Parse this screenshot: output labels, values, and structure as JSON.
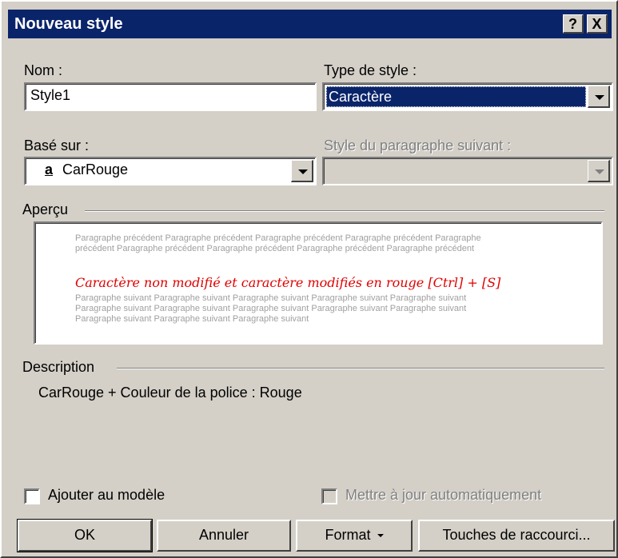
{
  "window": {
    "title": "Nouveau style",
    "help_label": "?",
    "close_label": "X"
  },
  "name_field": {
    "label": "Nom :",
    "value": "Style1"
  },
  "style_type": {
    "label": "Type de style :",
    "value": "Caractère"
  },
  "based_on": {
    "label": "Basé sur :",
    "glyph": "a",
    "value": "CarRouge"
  },
  "next_style": {
    "label": "Style du paragraphe suivant :",
    "value": ""
  },
  "preview": {
    "label": "Aperçu",
    "previous_text": "Paragraphe précédent Paragraphe précédent Paragraphe précédent Paragraphe précédent Paragraphe précédent Paragraphe précédent Paragraphe précédent Paragraphe précédent Paragraphe précédent",
    "sample_text": "Caractère non modifié et caractère modifiés en rouge [Ctrl] + [S]",
    "following_text": "Paragraphe suivant Paragraphe suivant Paragraphe suivant Paragraphe suivant Paragraphe suivant Paragraphe suivant Paragraphe suivant Paragraphe suivant Paragraphe suivant Paragraphe suivant Paragraphe suivant Paragraphe suivant Paragraphe suivant"
  },
  "description": {
    "label": "Description",
    "text": "CarRouge + Couleur de la police : Rouge"
  },
  "options": {
    "add_to_template": "Ajouter au modèle",
    "auto_update": "Mettre à jour automatiquement"
  },
  "buttons": {
    "ok": "OK",
    "cancel": "Annuler",
    "format": "Format",
    "shortcut": "Touches de raccourci..."
  },
  "colors": {
    "title_bar": "#0a246a",
    "face": "#d4d0c8",
    "preview_red": "#e00000"
  }
}
